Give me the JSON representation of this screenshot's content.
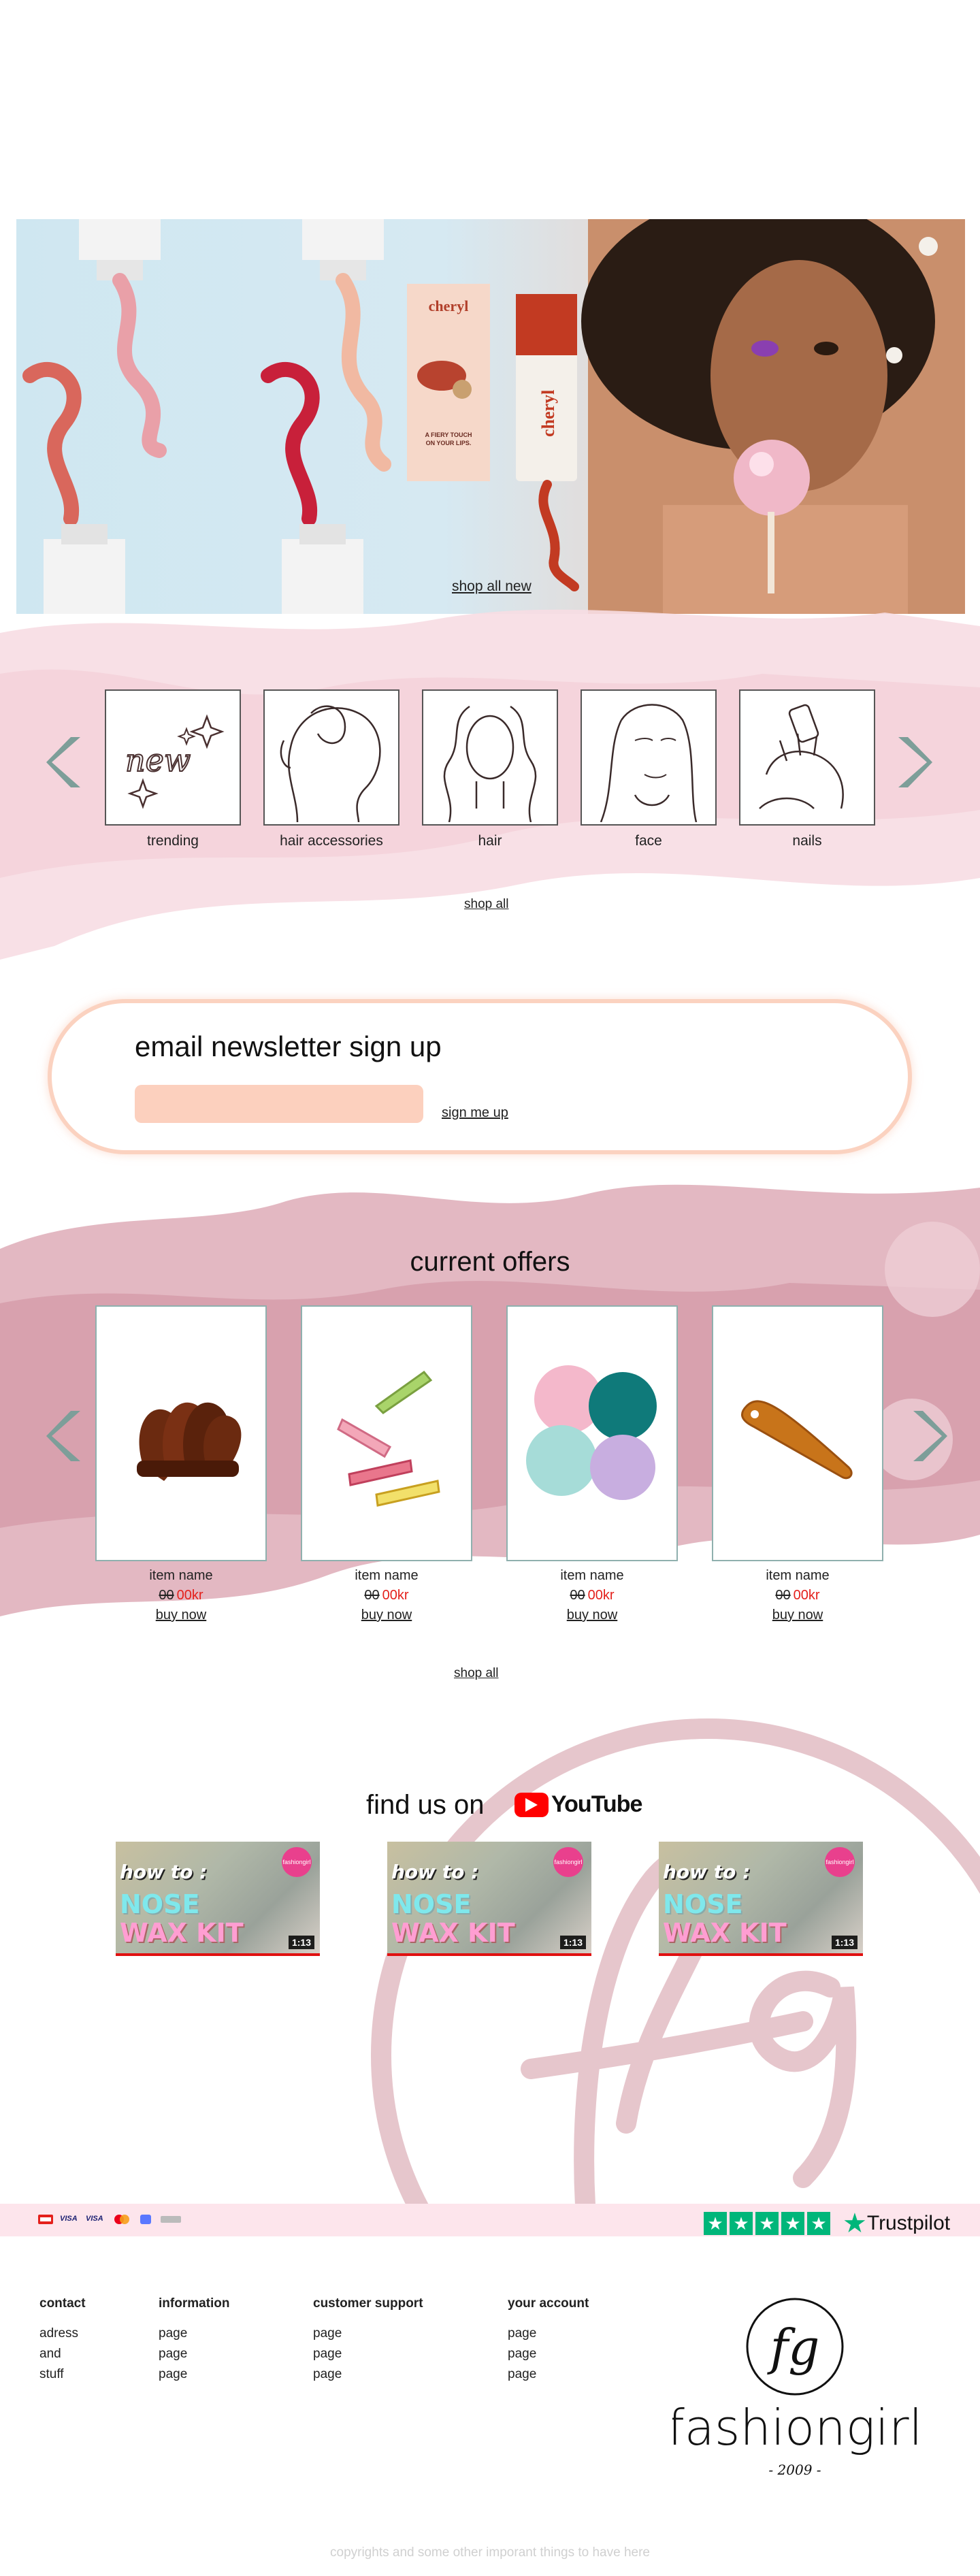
{
  "hero": {
    "cta": "shop all new",
    "product_brand": "cheryl",
    "box_tagline": "A FIERY TOUCH ON YOUR LIPS."
  },
  "categories": {
    "items": [
      {
        "label": "trending",
        "art_text": "new"
      },
      {
        "label": "hair accessories"
      },
      {
        "label": "hair"
      },
      {
        "label": "face"
      },
      {
        "label": "nails"
      }
    ],
    "shop_all": "shop all"
  },
  "newsletter": {
    "title": "email newsletter sign up",
    "input_placeholder": "",
    "button": "sign me up"
  },
  "offers": {
    "title": "current offers",
    "items": [
      {
        "name": "item name",
        "old_price": "00",
        "new_price": "00kr",
        "cta": "buy now"
      },
      {
        "name": "item name",
        "old_price": "00",
        "new_price": "00kr",
        "cta": "buy now"
      },
      {
        "name": "item name",
        "old_price": "00",
        "new_price": "00kr",
        "cta": "buy now"
      },
      {
        "name": "item name",
        "old_price": "00",
        "new_price": "00kr",
        "cta": "buy now"
      }
    ],
    "shop_all": "shop all"
  },
  "youtube": {
    "title": "find us on",
    "logo_word": "YouTube",
    "videos": [
      {
        "line1": "how to :",
        "line2": "NOSE",
        "line3": "WAX KIT",
        "duration": "1:13",
        "badge": "fashiongirl"
      },
      {
        "line1": "how to :",
        "line2": "NOSE",
        "line3": "WAX KIT",
        "duration": "1:13",
        "badge": "fashiongirl"
      },
      {
        "line1": "how to :",
        "line2": "NOSE",
        "line3": "WAX KIT",
        "duration": "1:13",
        "badge": "fashiongirl"
      }
    ]
  },
  "payments": {
    "visa1": "VISA",
    "visa2": "VISA"
  },
  "trustpilot": {
    "word": "Trustpilot",
    "stars": 5
  },
  "footer": {
    "columns": [
      {
        "heading": "contact",
        "links": [
          "adress",
          "and",
          "stuff"
        ]
      },
      {
        "heading": "information",
        "links": [
          "page",
          "page",
          "page"
        ]
      },
      {
        "heading": "customer support",
        "links": [
          "page",
          "page",
          "page"
        ]
      },
      {
        "heading": "your account",
        "links": [
          "page",
          "page",
          "page"
        ]
      }
    ],
    "brand_name": "fashiongirl",
    "brand_monogram": "fg",
    "brand_year": "- 2009 -",
    "copyright": "copyrights and some other imporant things to have here"
  },
  "colors": {
    "accent_pink": "#e7b9c4",
    "peach": "#fcd0be",
    "teal_arrow": "#7d9e99",
    "sale_red": "#e4201b",
    "trustpilot_green": "#00b67a"
  }
}
